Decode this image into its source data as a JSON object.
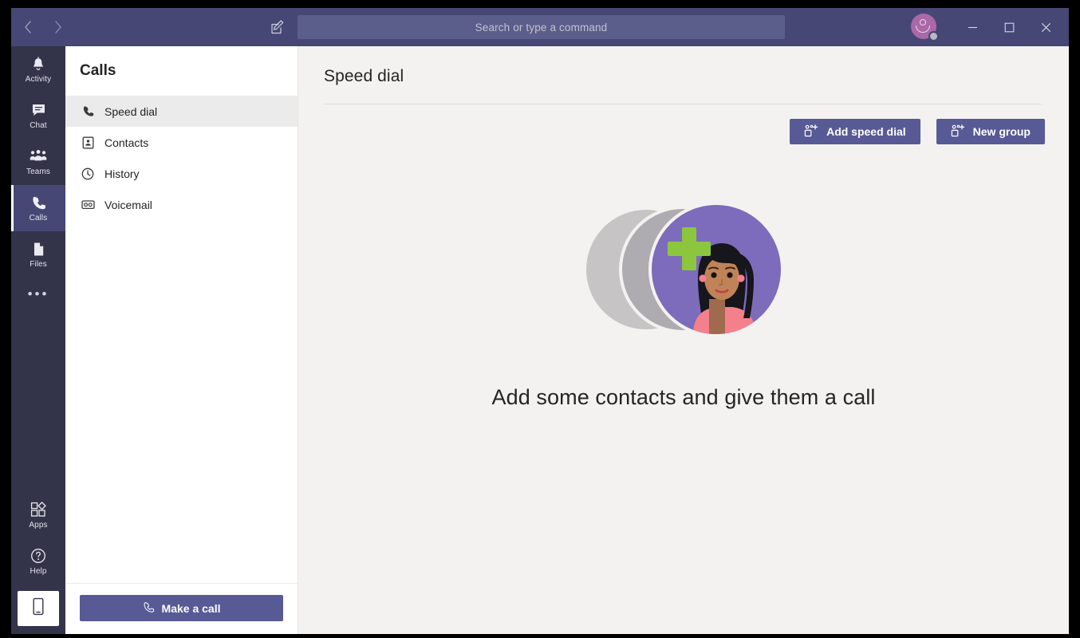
{
  "titlebar": {
    "back_icon": "chevron-left-icon",
    "forward_icon": "chevron-right-icon",
    "compose_icon": "compose-icon",
    "minimize_label": "─",
    "maximize_label": "□",
    "close_label": "✕",
    "avatar_name": "user-avatar",
    "presence": "away"
  },
  "search": {
    "placeholder": "Search or type a command",
    "value": ""
  },
  "rail": {
    "items": [
      {
        "label": "Activity",
        "icon": "bell-icon",
        "selected": false
      },
      {
        "label": "Chat",
        "icon": "chat-bubble-icon",
        "selected": false
      },
      {
        "label": "Teams",
        "icon": "teams-people-icon",
        "selected": false
      },
      {
        "label": "Calls",
        "icon": "phone-icon",
        "selected": true
      },
      {
        "label": "Files",
        "icon": "file-icon",
        "selected": false
      }
    ],
    "more_label": "•••",
    "bottom_items": [
      {
        "label": "Apps",
        "icon": "apps-grid-icon"
      },
      {
        "label": "Help",
        "icon": "help-question-icon"
      }
    ],
    "download_app_icon": "mobile-phone-icon"
  },
  "sidebar": {
    "title": "Calls",
    "items": [
      {
        "label": "Speed dial",
        "icon": "phone-icon",
        "active": true
      },
      {
        "label": "Contacts",
        "icon": "contact-card-icon",
        "active": false
      },
      {
        "label": "History",
        "icon": "clock-icon",
        "active": false
      },
      {
        "label": "Voicemail",
        "icon": "voicemail-tape-icon",
        "active": false
      }
    ],
    "make_call_label": "Make a call",
    "make_call_icon": "phone-icon"
  },
  "main": {
    "title": "Speed dial",
    "add_speed_dial_label": "Add speed dial",
    "add_speed_dial_icon": "add-person-icon",
    "new_group_label": "New group",
    "new_group_icon": "add-person-icon",
    "empty_state_text": "Add some contacts and give them a call",
    "illustration_name": "add-contacts-illustration"
  },
  "colors": {
    "titlebar_purple": "#464775",
    "rail_dark": "#33344a",
    "accent_button": "#585a96",
    "selected_rail": "#464775",
    "content_bg": "#f3f2f1",
    "sidebar_selected": "#ebebeb",
    "illustration_purple": "#7d6cbb",
    "illustration_green": "#8cc63e"
  }
}
